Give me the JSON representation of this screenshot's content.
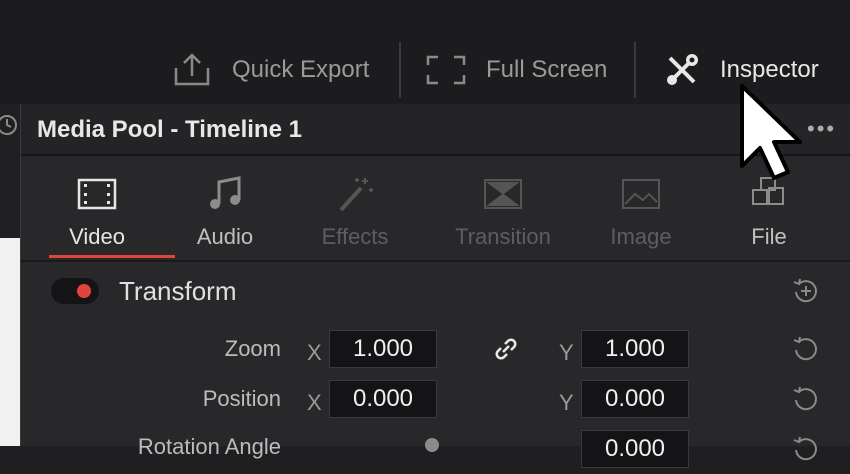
{
  "topbar": {
    "quick_export": {
      "label": "Quick Export",
      "icon": "upload-tray-icon"
    },
    "full_screen": {
      "label": "Full Screen",
      "icon": "fullscreen-frame-icon"
    },
    "inspector": {
      "label": "Inspector",
      "icon": "wrench-screwdriver-icon"
    }
  },
  "panel": {
    "title": "Media Pool - Timeline 1",
    "more_label": "•••",
    "tabs": [
      {
        "label": "Video",
        "icon": "film-strip-icon",
        "state": "active"
      },
      {
        "label": "Audio",
        "icon": "music-note-icon",
        "state": "normal"
      },
      {
        "label": "Effects",
        "icon": "magic-wand-icon",
        "state": "disabled"
      },
      {
        "label": "Transition",
        "icon": "transition-icon",
        "state": "disabled"
      },
      {
        "label": "Image",
        "icon": "image-icon",
        "state": "disabled"
      },
      {
        "label": "File",
        "icon": "file-cubes-icon",
        "state": "normal"
      }
    ],
    "section": {
      "title": "Transform",
      "enabled": true
    },
    "rows": [
      {
        "label": "Zoom",
        "x_axis": "X",
        "x_value": "1.000",
        "y_axis": "Y",
        "y_value": "1.000",
        "linked": true
      },
      {
        "label": "Position",
        "x_axis": "X",
        "x_value": "0.000",
        "y_axis": "Y",
        "y_value": "0.000"
      },
      {
        "label": "Rotation Angle",
        "y_value": "0.000"
      }
    ]
  },
  "colors": {
    "accent": "#e0443a",
    "panel_bg": "#28282a",
    "field_bg": "#141416"
  }
}
